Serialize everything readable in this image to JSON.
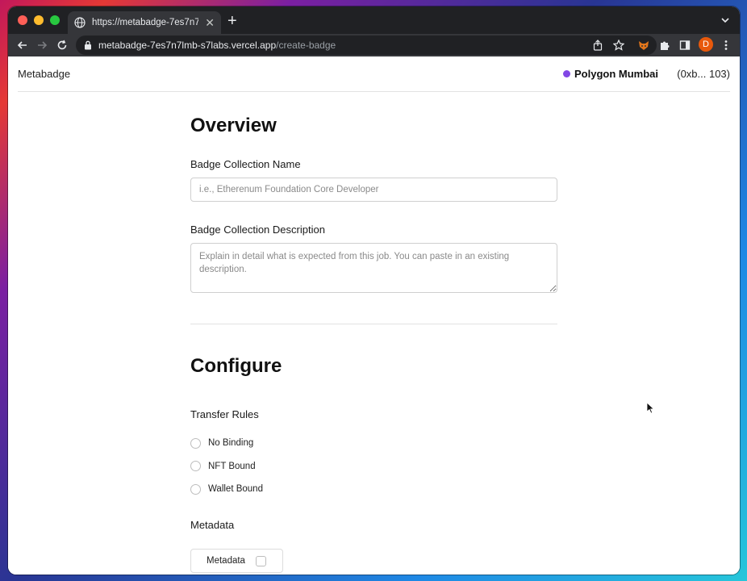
{
  "browser": {
    "tab_title": "https://metabadge-7es7n7lmb",
    "url_host": "metabadge-7es7n7lmb-s7labs.vercel.app",
    "url_path": "/create-badge",
    "profile_initial": "D",
    "icons": [
      "globe-icon",
      "close-icon",
      "plus-icon",
      "chevron-down-icon",
      "back-icon",
      "forward-icon",
      "reload-icon",
      "lock-icon",
      "share-icon",
      "star-icon",
      "fox-extension-icon",
      "puzzle-icon",
      "sidebar-icon",
      "kebab-menu-icon"
    ]
  },
  "header": {
    "brand": "Metabadge",
    "network": "Polygon Mumbai",
    "network_color": "#8247e5",
    "account": "(0xb... 103)"
  },
  "overview": {
    "title": "Overview",
    "name_label": "Badge Collection Name",
    "name_placeholder": "i.e., Etherenum Foundation Core Developer",
    "name_value": "",
    "description_label": "Badge Collection Description",
    "description_placeholder": "Explain in detail what is expected from this job. You can paste in an existing description.",
    "description_value": ""
  },
  "configure": {
    "title": "Configure",
    "transfer_rules_label": "Transfer Rules",
    "transfer_options": [
      "No Binding",
      "NFT Bound",
      "Wallet Bound"
    ],
    "metadata_label": "Metadata",
    "metadata_checkbox_label": "Metadata",
    "metadata_checked": false
  }
}
